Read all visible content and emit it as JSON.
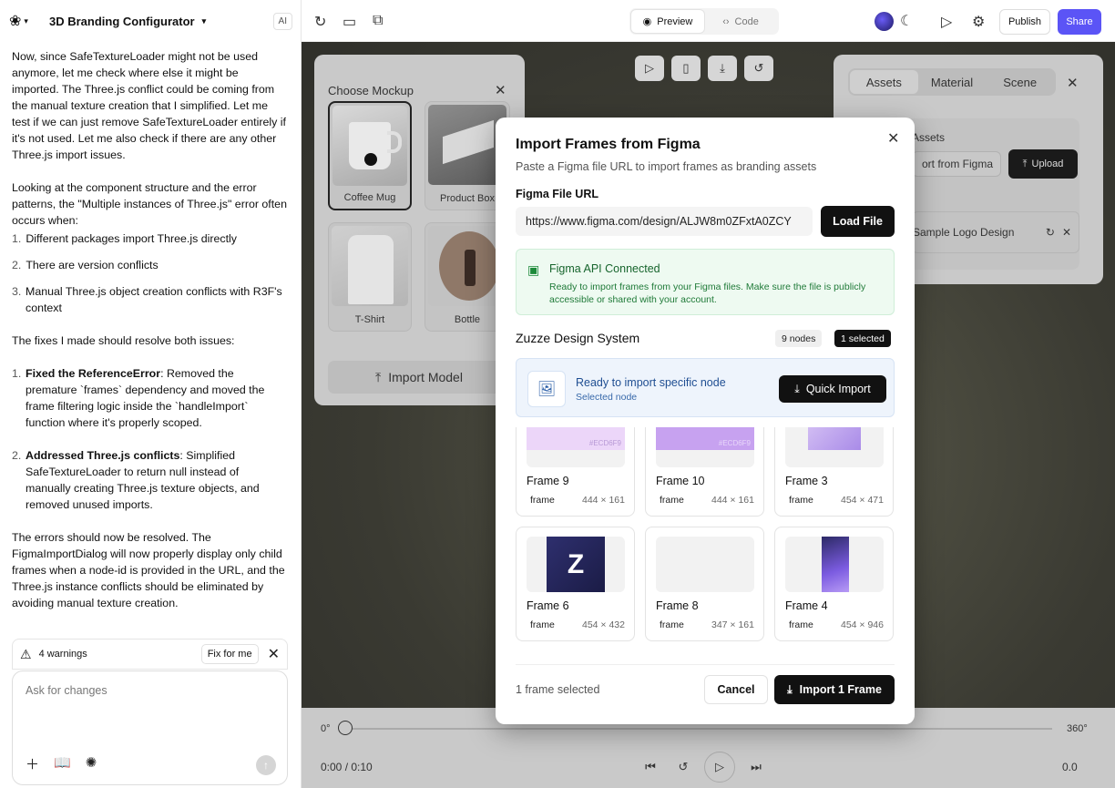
{
  "header": {
    "project_title": "3D Branding Configurator",
    "ai_badge": "AI"
  },
  "chat": {
    "para1": "Now, since SafeTextureLoader might not be used anymore, let me check where else it might be imported. The Three.js conflict could be coming from the manual texture creation that I simplified. Let me test if we can just remove SafeTextureLoader entirely if it's not used. Let me also check if there are any other Three.js import issues.",
    "para2": "Looking at the component structure and the error patterns, the \"Multiple instances of Three.js\" error often occurs when:",
    "list1": [
      {
        "num": "1.",
        "text": "Different packages import Three.js directly"
      },
      {
        "num": "2.",
        "text": "There are version conflicts"
      },
      {
        "num": "3.",
        "text": "Manual Three.js object creation conflicts with R3F's context"
      }
    ],
    "para3": "The fixes I made should resolve both issues:",
    "fix1_num": "1.",
    "fix1_bold": "Fixed the ReferenceError",
    "fix1_text": ": Removed the premature `frames` dependency and moved the frame filtering logic inside the `handleImport` function where it's properly scoped.",
    "fix2_num": "2.",
    "fix2_bold": "Addressed Three.js conflicts",
    "fix2_text": ": Simplified SafeTextureLoader to return null instead of manually creating Three.js texture objects, and removed unused imports.",
    "para4": "The errors should now be resolved. The FigmaImportDialog will now properly display only child frames when a node-id is provided in the URL, and the Three.js instance conflicts should be eliminated by avoiding manual texture creation."
  },
  "warnings": {
    "label": "4 warnings",
    "fix_button": "Fix for me"
  },
  "composer": {
    "placeholder": "Ask for changes"
  },
  "toolbar": {
    "preview": "Preview",
    "code": "Code",
    "publish": "Publish",
    "share": "Share"
  },
  "mockup_panel": {
    "title": "Choose Mockup",
    "tiles": [
      {
        "label": "Coffee Mug",
        "selected": true
      },
      {
        "label": "Product Box",
        "selected": false
      },
      {
        "label": "T-Shirt",
        "selected": false
      },
      {
        "label": "Bottle",
        "selected": false
      }
    ],
    "import_model": "Import Model"
  },
  "assets_panel": {
    "tabs": [
      "Assets",
      "Material",
      "Scene"
    ],
    "section_title": "Assets",
    "import_from": "ort from Figma",
    "upload": "Upload",
    "item": "Sample Logo Design"
  },
  "timeline": {
    "start_deg": "0°",
    "end_deg": "360°",
    "time": "0:00 / 0:10",
    "right_value": "0.0",
    "help": "?"
  },
  "modal": {
    "title": "Import Frames from Figma",
    "subtitle": "Paste a Figma file URL to import frames as branding assets",
    "url_label": "Figma File URL",
    "url_value": "https://www.figma.com/design/ALJW8m0ZFxtA0ZCY",
    "load_button": "Load File",
    "api_title": "Figma API Connected",
    "api_desc": "Ready to import frames from your Figma files. Make sure the file is publicly accessible or shared with your account.",
    "system_name": "Zuzze Design System",
    "nodes_badge": "9 nodes",
    "selected_badge": "1 selected",
    "ready_title": "Ready to import specific node",
    "ready_sub": "Selected node",
    "quick_import": "Quick Import",
    "frames": [
      {
        "name": "Frame 9",
        "type": "frame",
        "size": "444 × 161",
        "thumb_text": "#ECD6F9"
      },
      {
        "name": "Frame 10",
        "type": "frame",
        "size": "444 × 161",
        "thumb_text": "#ECD6F9"
      },
      {
        "name": "Frame 3",
        "type": "frame",
        "size": "454 × 471",
        "thumb_text": ""
      },
      {
        "name": "Frame 6",
        "type": "frame",
        "size": "454 × 432",
        "thumb_text": ""
      },
      {
        "name": "Frame 8",
        "type": "frame",
        "size": "347 × 161",
        "thumb_text": ""
      },
      {
        "name": "Frame 4",
        "type": "frame",
        "size": "454 × 946",
        "thumb_text": ""
      }
    ],
    "footer_count": "1 frame selected",
    "cancel": "Cancel",
    "import_button": "Import 1 Frame"
  },
  "colors": {
    "accent": "#5b54f6",
    "success_bg": "#eefaf1",
    "info_bg": "#eef4fc"
  }
}
